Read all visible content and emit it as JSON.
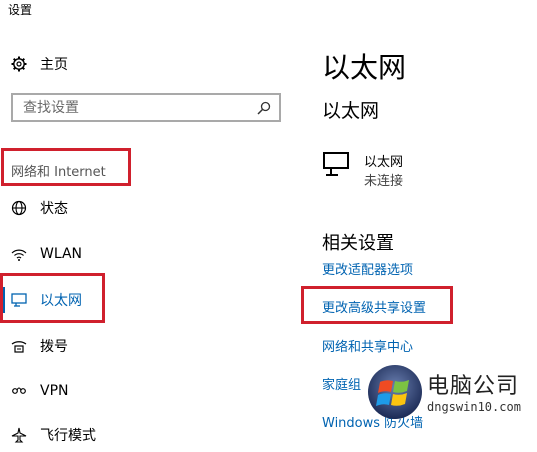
{
  "window": {
    "title": "设置"
  },
  "sidebar": {
    "home_label": "主页",
    "search_placeholder": "查找设置",
    "section_title": "网络和 Internet",
    "items": [
      {
        "label": "状态",
        "icon": "status-globe-icon"
      },
      {
        "label": "WLAN",
        "icon": "wifi-icon"
      },
      {
        "label": "以太网",
        "icon": "ethernet-icon",
        "selected": true
      },
      {
        "label": "拨号",
        "icon": "dialup-icon"
      },
      {
        "label": "VPN",
        "icon": "vpn-icon"
      },
      {
        "label": "飞行模式",
        "icon": "airplane-icon"
      }
    ]
  },
  "main": {
    "title": "以太网",
    "section_title": "以太网",
    "network": {
      "name": "以太网",
      "status": "未连接"
    },
    "related_title": "相关设置",
    "links": [
      "更改适配器选项",
      "更改高级共享设置",
      "网络和共享中心",
      "家庭组",
      "Windows 防火墙"
    ]
  },
  "watermark": {
    "name": "电脑公司",
    "url": "dngswin10.com"
  },
  "colors": {
    "accent": "#0063b1",
    "highlight_box": "#d0202d"
  }
}
